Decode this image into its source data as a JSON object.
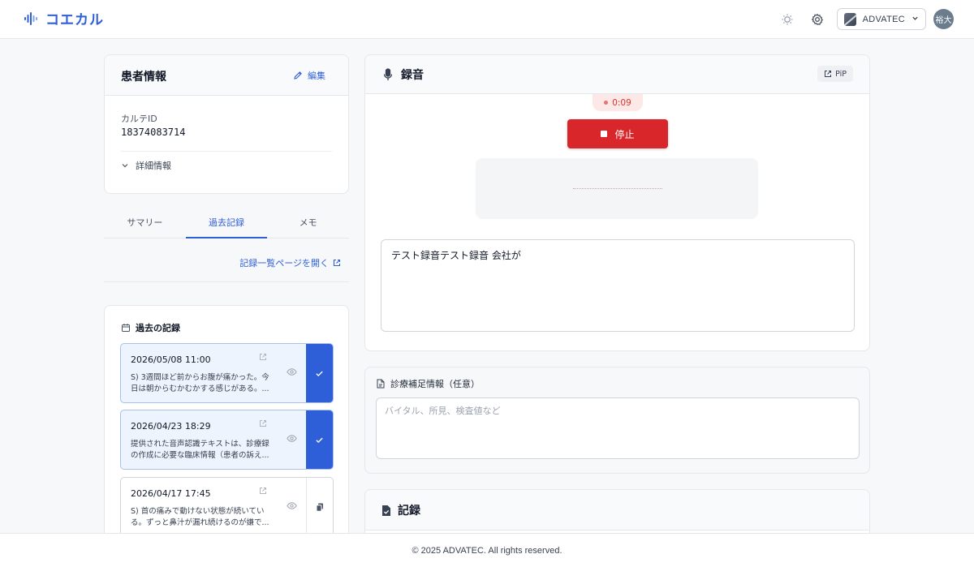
{
  "header": {
    "app_name": "コエカル",
    "org_name": "ADVATEC",
    "user_initials": "裕大"
  },
  "patient": {
    "title": "患者情報",
    "edit_label": "編集",
    "karte_label": "カルテID",
    "karte_id": "18374083714",
    "details_label": "詳細情報"
  },
  "tabs": [
    {
      "label": "サマリー"
    },
    {
      "label": "過去記録"
    },
    {
      "label": "メモ"
    }
  ],
  "active_tab": "過去記録",
  "record_list_link": "記録一覧ページを開く",
  "past_records": {
    "title": "過去の記録",
    "items": [
      {
        "date": "2026/05/08 11:00",
        "text": "S) 3週間ほど前からお腹が痛かった。今日は朝からむかむかする感じがある。...",
        "selected": true
      },
      {
        "date": "2026/04/23 18:29",
        "text": "提供された音声認識テキストは、診療録の作成に必要な臨床情報（患者の訴え...",
        "selected": true
      },
      {
        "date": "2026/04/17 17:45",
        "text": "S) 首の痛みで動けない状態が続いている。ずっと鼻汁が漏れ続けるのが嫌で...",
        "selected": false
      }
    ]
  },
  "recording": {
    "title": "録音",
    "pip_label": "PiP",
    "timer": "0:09",
    "stop_label": "停止",
    "transcript": "テスト録音テスト録音 会社が"
  },
  "supplement": {
    "title": "診療補足情報（任意）",
    "placeholder": "バイタル、所見、検査値など"
  },
  "kiroku": {
    "title": "記録"
  },
  "footer": {
    "copyright": "© 2025 ADVATEC. All rights reserved."
  },
  "colors": {
    "accent": "#2f5fd8",
    "stop": "#d9262a",
    "selected_bg": "#eef4fe"
  }
}
